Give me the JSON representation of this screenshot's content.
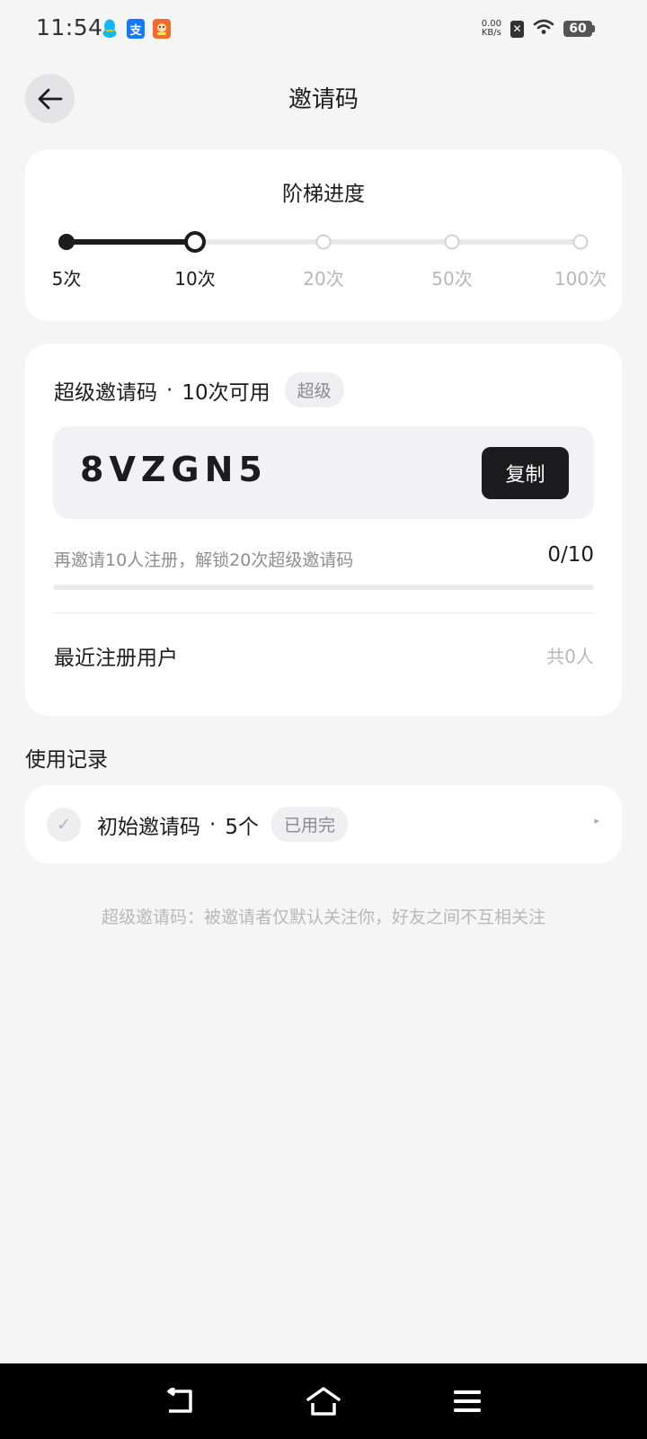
{
  "status_bar": {
    "time": "11:54",
    "net_speed_value": "0.00",
    "net_speed_unit": "KB/s",
    "battery_level": "60",
    "apps": [
      {
        "icon": "qq-icon"
      },
      {
        "icon": "alipay-icon",
        "glyph": "支"
      },
      {
        "icon": "game-app-icon"
      }
    ]
  },
  "header": {
    "title": "邀请码"
  },
  "ladder": {
    "title": "阶梯进度",
    "nodes": [
      {
        "label": "5次",
        "state": "done"
      },
      {
        "label": "10次",
        "state": "current"
      },
      {
        "label": "20次",
        "state": "future"
      },
      {
        "label": "50次",
        "state": "future"
      },
      {
        "label": "100次",
        "state": "future"
      }
    ],
    "progress_fraction": 0.25
  },
  "invite": {
    "title": "超级邀请码",
    "separator": "·",
    "available": "10次可用",
    "tag": "超级",
    "code": "8VZGN5",
    "copy_label": "复制",
    "unlock_hint": "再邀请10人注册，解锁20次超级邀请码",
    "unlock_progress_text": "0/10",
    "unlock_progress_fraction": 0,
    "recent_label": "最近注册用户",
    "recent_total": "共0人"
  },
  "records": {
    "section_title": "使用记录",
    "items": [
      {
        "check_glyph": "✓",
        "name": "初始邀请码",
        "separator": "·",
        "count": "5个",
        "status": "已用完"
      }
    ]
  },
  "footnote": "超级邀请码：被邀请者仅默认关注你，好友之间不互相关注",
  "colors": {
    "background": "#f5f5f5",
    "card": "#ffffff",
    "accent": "#1c1c1e",
    "muted_text": "#b8b8ba",
    "tag_bg": "#efeff1"
  }
}
